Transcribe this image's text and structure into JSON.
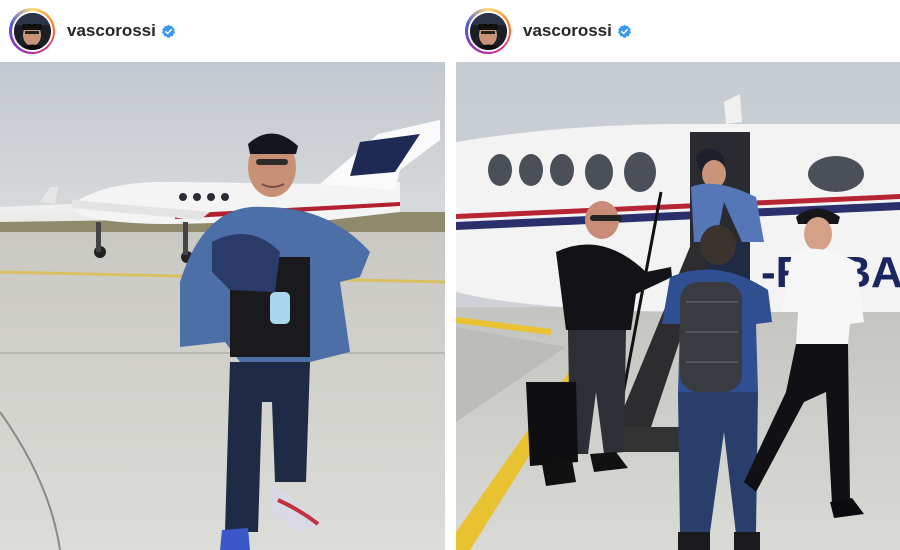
{
  "posts": [
    {
      "username": "vascorossi",
      "verified": true,
      "avatar_icon": "profile-avatar",
      "photo_icon": "man-with-shoulder-brace-on-tarmac-photo"
    },
    {
      "username": "vascorossi",
      "verified": true,
      "avatar_icon": "profile-avatar",
      "photo_icon": "group-boarding-private-jet-photo"
    }
  ],
  "colors": {
    "verified_blue": "#3897f0",
    "username_text": "#262626",
    "sky": "#c9ced3",
    "tarmac": "#cfcfcc",
    "tarmac_stripe": "#e8c230"
  }
}
